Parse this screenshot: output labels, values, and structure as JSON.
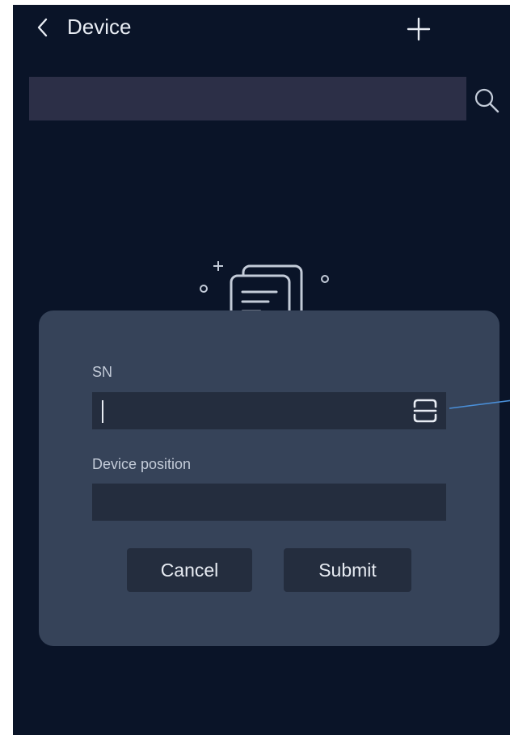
{
  "header": {
    "title": "Device",
    "back_icon": "chevron-left-icon",
    "add_icon": "plus-icon"
  },
  "search": {
    "value": "",
    "icon": "search-icon"
  },
  "dialog": {
    "sn_label": "SN",
    "sn_value": "",
    "scan_icon": "scan-icon",
    "position_label": "Device position",
    "position_value": "",
    "cancel_label": "Cancel",
    "submit_label": "Submit"
  },
  "colors": {
    "background": "#0a1428",
    "search_bg": "#2c2f47",
    "dialog_bg": "#364359",
    "field_bg": "#242d3e",
    "text": "#e8ecf3",
    "label": "#c3cbd8",
    "callout": "#4a8fd8"
  }
}
